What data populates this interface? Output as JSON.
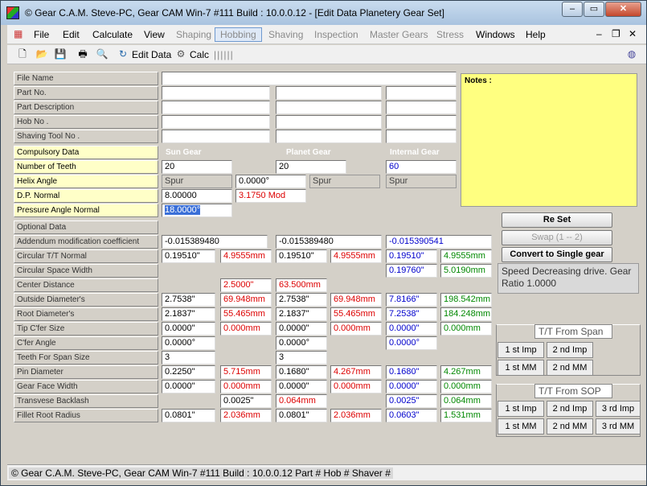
{
  "window": {
    "title": "© Gear C.A.M. Steve-PC, Gear CAM Win-7 #111 Build : 10.0.0.12 - [Edit Data Planetery  Gear Set]"
  },
  "menu": {
    "items": [
      "File",
      "Edit",
      "Calculate",
      "View",
      "Shaping",
      "Hobbing",
      "Shaving",
      "Inspection",
      "Master Gears",
      "Stress",
      "Windows",
      "Help"
    ]
  },
  "toolbar": {
    "edit_data": "Edit Data",
    "calc": "Calc",
    "separator": "||||||"
  },
  "header_labels": {
    "file_name": "File Name",
    "part_no": "Part No.",
    "part_desc": "Part Description",
    "hob_no": "Hob No .",
    "shaving_tool": "Shaving Tool No ."
  },
  "notes_label": "Notes :",
  "compulsory": {
    "title": "Compulsory Data",
    "col_sun": "Sun Gear",
    "col_planet": "Planet Gear",
    "col_internal": "Internal Gear",
    "teeth_label": "Number of Teeth",
    "teeth_sun": "20",
    "teeth_planet": "20",
    "teeth_internal": "60",
    "helix_label": "Helix Angle",
    "helix_sun": "Spur",
    "helix_val": "0.0000°",
    "helix_planet": "Spur",
    "helix_internal": "Spur",
    "dp_label": "D.P. Normal",
    "dp_val": "8.00000",
    "mod_val": "3.1750 Mod",
    "pa_label": "Pressure Angle Normal",
    "pa_val": "18.0000°"
  },
  "optional_title": "Optional Data",
  "rows": [
    {
      "label": "Addendum modification coefficient",
      "cells": [
        "-0.015389480",
        "",
        "-0.015389480",
        "",
        "-0.015390541",
        ""
      ]
    },
    {
      "label": "Circular T/T Normal",
      "cells": [
        "0.19510\"",
        "4.9555mm",
        "0.19510\"",
        "4.9555mm",
        "0.19510\"",
        "4.9555mm"
      ]
    },
    {
      "label": "Circular Space Width",
      "cells": [
        "",
        "",
        "",
        "",
        "0.19760\"",
        "5.0190mm"
      ]
    },
    {
      "label": "Center Distance",
      "cells": [
        "",
        "2.5000\"",
        "63.500mm",
        "",
        "",
        ""
      ]
    },
    {
      "label": "Outside Diameter's",
      "cells": [
        "2.7538\"",
        "69.948mm",
        "2.7538\"",
        "69.948mm",
        "7.8166\"",
        "198.542mm"
      ]
    },
    {
      "label": "Root Diameter's",
      "cells": [
        "2.1837\"",
        "55.465mm",
        "2.1837\"",
        "55.465mm",
        "7.2538\"",
        "184.248mm"
      ]
    },
    {
      "label": "Tip C'fer Size",
      "cells": [
        "0.0000\"",
        "0.000mm",
        "0.0000\"",
        "0.000mm",
        "0.0000\"",
        "0.000mm"
      ]
    },
    {
      "label": " C'fer Angle",
      "cells": [
        "0.0000°",
        "",
        "0.0000°",
        "",
        "0.0000°",
        ""
      ]
    },
    {
      "label": "Teeth For Span Size",
      "cells": [
        "3",
        "",
        "3",
        "",
        "",
        ""
      ]
    },
    {
      "label": "Pin Diameter",
      "cells": [
        "0.2250\"",
        "5.715mm",
        "0.1680\"",
        "4.267mm",
        "0.1680\"",
        "4.267mm"
      ]
    },
    {
      "label": "Gear Face Width",
      "cells": [
        "0.0000\"",
        "0.000mm",
        "0.0000\"",
        "0.000mm",
        "0.0000\"",
        "0.000mm"
      ]
    },
    {
      "label": "Transvese Backlash",
      "cells": [
        "",
        "0.0025\"",
        "0.064mm",
        "",
        "0.0025\"",
        "0.064mm"
      ]
    },
    {
      "label": "Fillet Root Radius",
      "cells": [
        "0.0801\"",
        "2.036mm",
        "0.0801\"",
        "2.036mm",
        "0.0603\"",
        "1.531mm"
      ]
    }
  ],
  "buttons": {
    "reset": "Re Set",
    "swap": "Swap (1 -- 2)",
    "convert": "Convert to Single gear"
  },
  "info_text": "Speed Decreasing drive. Gear Ratio 1.0000",
  "span_group": {
    "title": "T/T From Span",
    "b1": "1 st Imp",
    "b2": "2 nd Imp",
    "b3": "1 st MM",
    "b4": "2 nd MM"
  },
  "sop_group": {
    "title": "T/T From SOP",
    "b1": "1 st Imp",
    "b2": "2 nd Imp",
    "b3": "3 rd Imp",
    "b4": "1 st MM",
    "b5": "2 nd MM",
    "b6": "3 rd MM"
  },
  "status": "© Gear C.A.M. Steve-PC, Gear CAM Win-7 #111 Build : 10.0.0.12  Part #  Hob #  Shaver #"
}
